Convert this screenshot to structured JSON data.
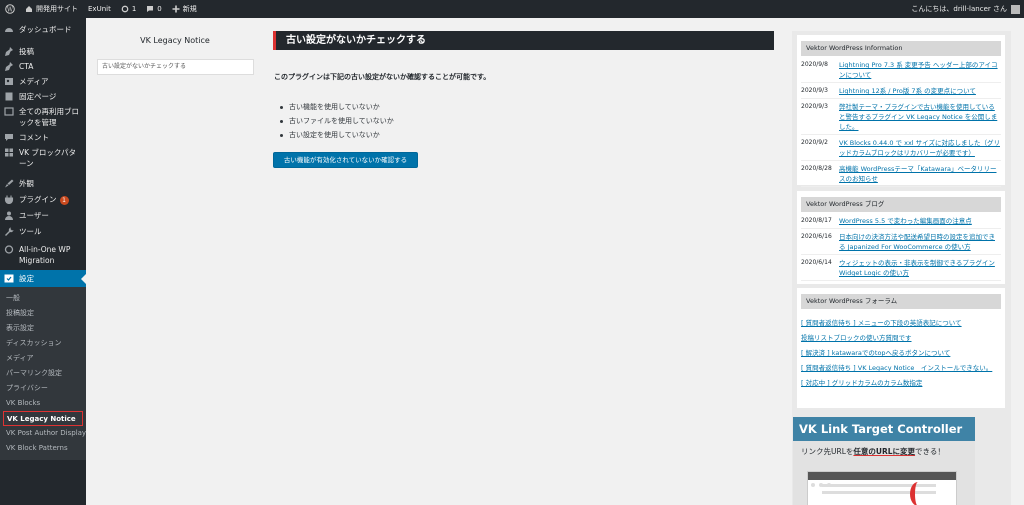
{
  "adminbar": {
    "site_name": "開発用サイト",
    "exunit": "ExUnit",
    "updates_count": "1",
    "comments_count": "0",
    "new_label": "新規",
    "greeting": "こんにちは、drill-lancer さん"
  },
  "sidebar": {
    "items": [
      {
        "label": "ダッシュボード",
        "icon": "dashboard-icon"
      },
      {
        "label": "投稿",
        "icon": "pin-icon"
      },
      {
        "label": "CTA",
        "icon": "pin-icon"
      },
      {
        "label": "メディア",
        "icon": "media-icon"
      },
      {
        "label": "固定ページ",
        "icon": "page-icon"
      },
      {
        "label": "全ての再利用ブロックを管理",
        "icon": "blocks-icon"
      },
      {
        "label": "コメント",
        "icon": "comment-icon"
      },
      {
        "label": "VK ブロックパターン",
        "icon": "grid-icon"
      },
      {
        "label": "外観",
        "icon": "brush-icon"
      },
      {
        "label": "プラグイン",
        "icon": "plugin-icon",
        "badge": "1"
      },
      {
        "label": "ユーザー",
        "icon": "user-icon"
      },
      {
        "label": "ツール",
        "icon": "wrench-icon"
      },
      {
        "label": "All-in-One WP Migration",
        "icon": "migration-icon"
      },
      {
        "label": "設定",
        "icon": "settings-icon"
      }
    ],
    "submenu": [
      "一般",
      "投稿設定",
      "表示設定",
      "ディスカッション",
      "メディア",
      "パーマリンク設定",
      "プライバシー",
      "VK Blocks",
      "VK Legacy Notice",
      "VK Post Author Display",
      "VK Block Patterns"
    ]
  },
  "legacy_notice": {
    "title": "VK Legacy Notice",
    "input_value": "古い設定がないかチェックする"
  },
  "main": {
    "heading": "古い設定がないかチェックする",
    "intro": "このプラグインは下記の古い設定がないか確認することが可能です。",
    "checks": [
      "古い機能を使用していないか",
      "古いファイルを使用していないか",
      "古い設定を使用していないか"
    ],
    "button": "古い機能が有効化されていないか確認する"
  },
  "info_widget": {
    "title": "Vektor WordPress Information",
    "items": [
      {
        "date": "2020/9/8",
        "text": "Lightning Pro 7.3 系 変更予告 ヘッダー上部のアイコンについて"
      },
      {
        "date": "2020/9/3",
        "text": "Lightning 12系 / Pro版 7系 の変更点について"
      },
      {
        "date": "2020/9/3",
        "text": "弊社製テーマ・プラグインで古い機能を使用していると警告するプラグイン VK Legacy Notice を公開しました。"
      },
      {
        "date": "2020/9/2",
        "text": "VK Blocks 0.44.0 で xxl サイズに対応しました（グリッドカラムブロックはリカバリーが必要です）"
      },
      {
        "date": "2020/8/28",
        "text": "高機能 WordPressテーマ「Katawara」ベータリリースのお知らせ"
      }
    ]
  },
  "blog_widget": {
    "title": "Vektor WordPress ブログ",
    "items": [
      {
        "date": "2020/8/17",
        "text": "WordPress 5.5 で変わった編集画面の注意点"
      },
      {
        "date": "2020/6/16",
        "text": "日本向けの決済方法や配送希望日時の設定を追加できる Japanized For WooCommerce の使い方"
      },
      {
        "date": "2020/6/14",
        "text": "ウィジェットの表示・非表示を制御できるプラグイン Widget Logic の使い方"
      }
    ]
  },
  "forum_widget": {
    "title": "Vektor WordPress フォーラム",
    "items": [
      "[ 質問者返信待ち ] メニューの下段の英語表記について",
      "投稿リストブロックの使い方質問です",
      "[ 解決済 ] katawaraでのtopへ戻るボタンについて",
      "[ 質問者返信待ち ] VK Legacy Notice　インストールできない。",
      "[ 対応中 ] グリッドカラムのカラム数指定"
    ]
  },
  "banner": {
    "title": "VK Link Target Controller",
    "sub_prefix": "リンク先URLを",
    "sub_highlight": "任意のURLに変更",
    "sub_suffix": "できる！"
  }
}
